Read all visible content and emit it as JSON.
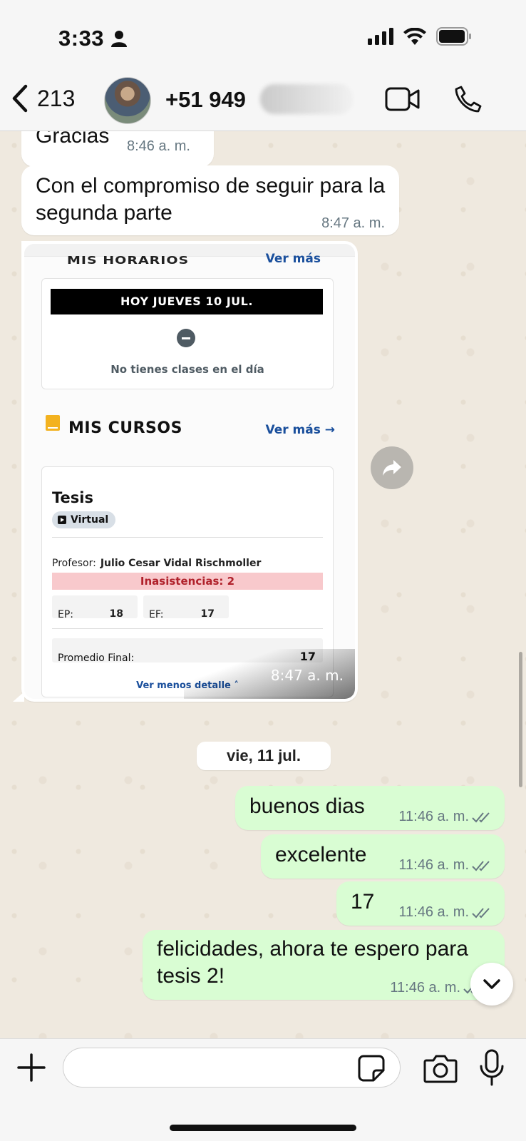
{
  "status_bar": {
    "time": "3:33"
  },
  "header": {
    "back_count": "213",
    "contact_name": "+51 949"
  },
  "messages": {
    "m1": {
      "text": "Gracias",
      "time": "8:46 a. m."
    },
    "m2": {
      "text": "Con el compromiso de seguir para la segunda parte",
      "time": "8:47 a. m."
    },
    "image": {
      "time": "8:47 a. m.",
      "horarios_label": "MIS HORARIOS",
      "horarios_vermas": "Ver más",
      "today_bar": "HOY JUEVES  10 JUL.",
      "no_classes": "No tienes clases en el día",
      "courses_title": "MIS CURSOS",
      "courses_vermas": "Ver más →",
      "course_name": "Tesis",
      "modality": "Virtual",
      "professor_label": "Profesor:",
      "professor_name": "Julio Cesar Vidal Rischmoller",
      "absences": "Inasistencias: 2",
      "ep_label": "EP:",
      "ep_value": "18",
      "ef_label": "EF:",
      "ef_value": "17",
      "final_label": "Promedio Final:",
      "final_value": "17",
      "less_detail": "Ver menos detalle  ˄"
    },
    "date_separator": "vie, 11 jul.",
    "out": [
      {
        "text": "buenos dias",
        "time": "11:46 a. m."
      },
      {
        "text": "excelente",
        "time": "11:46 a. m."
      },
      {
        "text": "17",
        "time": "11:46 a. m."
      },
      {
        "text": "felicidades, ahora te espero para tesis 2!",
        "time": "11:46 a. m."
      }
    ]
  },
  "composer": {
    "value": "",
    "placeholder": ""
  },
  "colors": {
    "incoming": "#ffffff",
    "outgoing": "#d9fdd3",
    "link_blue": "#1a4f9c",
    "absence_red": "#b0212b"
  },
  "icons": [
    "person-icon",
    "signal-icon",
    "wifi-icon",
    "battery-icon",
    "back-chevron-icon",
    "video-call-icon",
    "phone-icon",
    "forward-icon",
    "double-check-icon",
    "chevron-down-icon",
    "plus-icon",
    "sticker-icon",
    "camera-icon",
    "microphone-icon"
  ]
}
